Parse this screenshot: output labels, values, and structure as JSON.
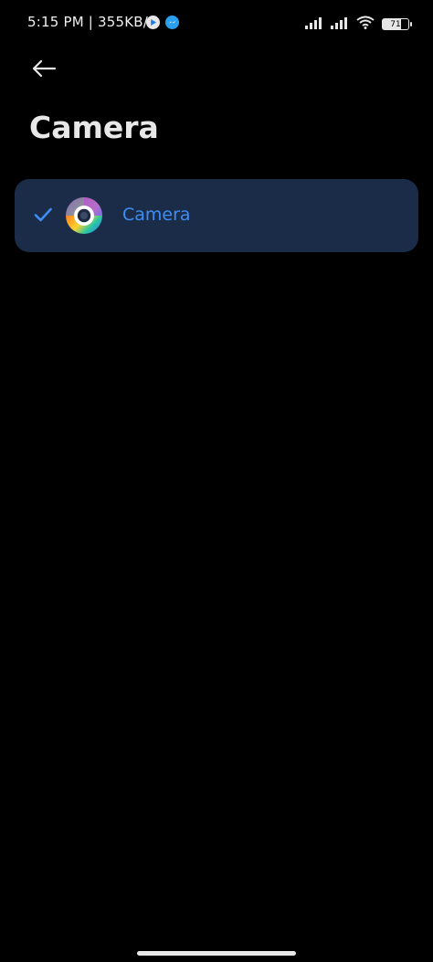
{
  "status_bar": {
    "time": "5:15 PM | 355KB/s",
    "battery": "71"
  },
  "header": {
    "title": "Camera"
  },
  "options": [
    {
      "label": "Camera",
      "selected": true
    }
  ],
  "colors": {
    "background": "#000000",
    "card": "#1b2c48",
    "accent": "#3d8df5",
    "title": "#e8e8e8"
  }
}
